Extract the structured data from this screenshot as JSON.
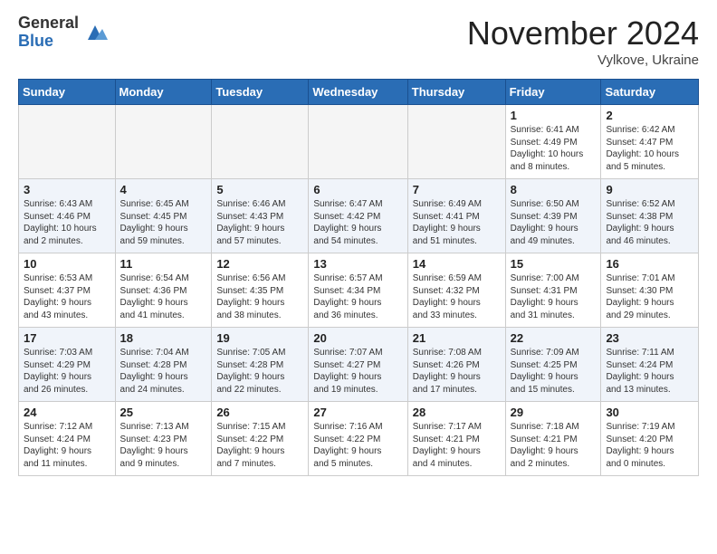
{
  "logo": {
    "general": "General",
    "blue": "Blue"
  },
  "header": {
    "month": "November 2024",
    "location": "Vylkove, Ukraine"
  },
  "weekdays": [
    "Sunday",
    "Monday",
    "Tuesday",
    "Wednesday",
    "Thursday",
    "Friday",
    "Saturday"
  ],
  "weeks": [
    [
      {
        "day": "",
        "info": ""
      },
      {
        "day": "",
        "info": ""
      },
      {
        "day": "",
        "info": ""
      },
      {
        "day": "",
        "info": ""
      },
      {
        "day": "",
        "info": ""
      },
      {
        "day": "1",
        "info": "Sunrise: 6:41 AM\nSunset: 4:49 PM\nDaylight: 10 hours\nand 8 minutes."
      },
      {
        "day": "2",
        "info": "Sunrise: 6:42 AM\nSunset: 4:47 PM\nDaylight: 10 hours\nand 5 minutes."
      }
    ],
    [
      {
        "day": "3",
        "info": "Sunrise: 6:43 AM\nSunset: 4:46 PM\nDaylight: 10 hours\nand 2 minutes."
      },
      {
        "day": "4",
        "info": "Sunrise: 6:45 AM\nSunset: 4:45 PM\nDaylight: 9 hours\nand 59 minutes."
      },
      {
        "day": "5",
        "info": "Sunrise: 6:46 AM\nSunset: 4:43 PM\nDaylight: 9 hours\nand 57 minutes."
      },
      {
        "day": "6",
        "info": "Sunrise: 6:47 AM\nSunset: 4:42 PM\nDaylight: 9 hours\nand 54 minutes."
      },
      {
        "day": "7",
        "info": "Sunrise: 6:49 AM\nSunset: 4:41 PM\nDaylight: 9 hours\nand 51 minutes."
      },
      {
        "day": "8",
        "info": "Sunrise: 6:50 AM\nSunset: 4:39 PM\nDaylight: 9 hours\nand 49 minutes."
      },
      {
        "day": "9",
        "info": "Sunrise: 6:52 AM\nSunset: 4:38 PM\nDaylight: 9 hours\nand 46 minutes."
      }
    ],
    [
      {
        "day": "10",
        "info": "Sunrise: 6:53 AM\nSunset: 4:37 PM\nDaylight: 9 hours\nand 43 minutes."
      },
      {
        "day": "11",
        "info": "Sunrise: 6:54 AM\nSunset: 4:36 PM\nDaylight: 9 hours\nand 41 minutes."
      },
      {
        "day": "12",
        "info": "Sunrise: 6:56 AM\nSunset: 4:35 PM\nDaylight: 9 hours\nand 38 minutes."
      },
      {
        "day": "13",
        "info": "Sunrise: 6:57 AM\nSunset: 4:34 PM\nDaylight: 9 hours\nand 36 minutes."
      },
      {
        "day": "14",
        "info": "Sunrise: 6:59 AM\nSunset: 4:32 PM\nDaylight: 9 hours\nand 33 minutes."
      },
      {
        "day": "15",
        "info": "Sunrise: 7:00 AM\nSunset: 4:31 PM\nDaylight: 9 hours\nand 31 minutes."
      },
      {
        "day": "16",
        "info": "Sunrise: 7:01 AM\nSunset: 4:30 PM\nDaylight: 9 hours\nand 29 minutes."
      }
    ],
    [
      {
        "day": "17",
        "info": "Sunrise: 7:03 AM\nSunset: 4:29 PM\nDaylight: 9 hours\nand 26 minutes."
      },
      {
        "day": "18",
        "info": "Sunrise: 7:04 AM\nSunset: 4:28 PM\nDaylight: 9 hours\nand 24 minutes."
      },
      {
        "day": "19",
        "info": "Sunrise: 7:05 AM\nSunset: 4:28 PM\nDaylight: 9 hours\nand 22 minutes."
      },
      {
        "day": "20",
        "info": "Sunrise: 7:07 AM\nSunset: 4:27 PM\nDaylight: 9 hours\nand 19 minutes."
      },
      {
        "day": "21",
        "info": "Sunrise: 7:08 AM\nSunset: 4:26 PM\nDaylight: 9 hours\nand 17 minutes."
      },
      {
        "day": "22",
        "info": "Sunrise: 7:09 AM\nSunset: 4:25 PM\nDaylight: 9 hours\nand 15 minutes."
      },
      {
        "day": "23",
        "info": "Sunrise: 7:11 AM\nSunset: 4:24 PM\nDaylight: 9 hours\nand 13 minutes."
      }
    ],
    [
      {
        "day": "24",
        "info": "Sunrise: 7:12 AM\nSunset: 4:24 PM\nDaylight: 9 hours\nand 11 minutes."
      },
      {
        "day": "25",
        "info": "Sunrise: 7:13 AM\nSunset: 4:23 PM\nDaylight: 9 hours\nand 9 minutes."
      },
      {
        "day": "26",
        "info": "Sunrise: 7:15 AM\nSunset: 4:22 PM\nDaylight: 9 hours\nand 7 minutes."
      },
      {
        "day": "27",
        "info": "Sunrise: 7:16 AM\nSunset: 4:22 PM\nDaylight: 9 hours\nand 5 minutes."
      },
      {
        "day": "28",
        "info": "Sunrise: 7:17 AM\nSunset: 4:21 PM\nDaylight: 9 hours\nand 4 minutes."
      },
      {
        "day": "29",
        "info": "Sunrise: 7:18 AM\nSunset: 4:21 PM\nDaylight: 9 hours\nand 2 minutes."
      },
      {
        "day": "30",
        "info": "Sunrise: 7:19 AM\nSunset: 4:20 PM\nDaylight: 9 hours\nand 0 minutes."
      }
    ]
  ]
}
